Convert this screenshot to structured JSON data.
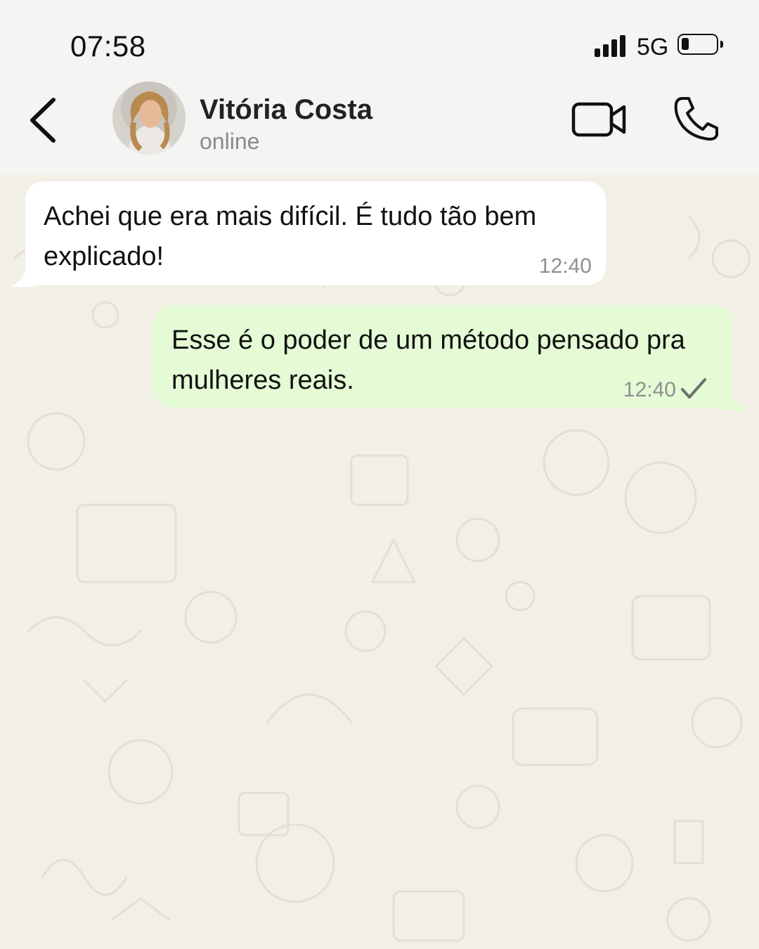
{
  "status_bar": {
    "time": "07:58",
    "network": "5G",
    "signal_bars": 4,
    "battery_level": 0.2
  },
  "header": {
    "contact_name": "Vitória Costa",
    "contact_status": "online",
    "icons": [
      "back-chevron-icon",
      "avatar",
      "video-call-icon",
      "phone-icon"
    ]
  },
  "messages": [
    {
      "direction": "incoming",
      "text": "Achei que era mais difícil. É tudo tão bem explicado!",
      "time": "12:40"
    },
    {
      "direction": "outgoing",
      "text": "Esse é o poder de um método pensado pra mulheres reais.",
      "time": "12:40",
      "status": "sent-check-icon"
    }
  ],
  "colors": {
    "header_bg": "#f4f4f2",
    "chat_bg": "#f2efe7",
    "incoming_bubble": "#ffffff",
    "outgoing_bubble": "#e4fbd5",
    "timestamp": "#8f8f8f"
  }
}
